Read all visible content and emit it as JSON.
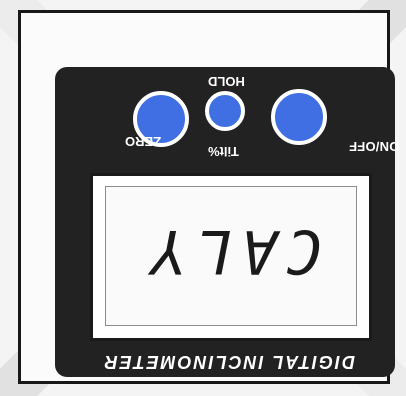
{
  "device": {
    "buttons": {
      "zero_label": "ZERO",
      "hold_label": "HOLD",
      "tilt_label": "Tilt%",
      "onoff_label": "ON/OFF"
    },
    "display": {
      "reading": "CALY"
    },
    "brand": {
      "bottom_label": "DIGITAL INCLINOMETER"
    }
  }
}
